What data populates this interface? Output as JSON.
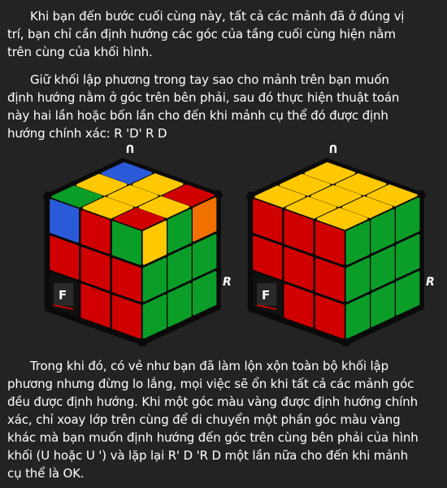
{
  "paragraphs": [
    {
      "lines": [
        "Khi bạn đến bước cuối cùng này, tất cả các mảnh đã ở đúng vị",
        "trí, bạn chỉ cần định hướng các góc của tầng cuối cùng hiện nằm",
        "trên cùng của khối hình."
      ]
    },
    {
      "lines": [
        "Giữ khối lập phương trong tay sao cho mảnh trên bạn muốn",
        "định hướng nằm ở góc trên bên phải, sau đó thực hiện thuật toán",
        "này hai lần hoặc bốn lần cho đến khi mảnh cụ thể đó được định",
        "hướng chính xác: R 'D' R D"
      ]
    },
    {
      "lines": [
        "Trong khi đó, có vẻ như bạn đã làm lộn xộn toàn bộ khối lập",
        "phương nhưng đừng lo lắng, mọi việc sẽ ổn khi tất cả các mảnh góc",
        "đều được định hướng. Khi một góc màu vàng được định hướng chính",
        "xác, chỉ xoay lớp trên cùng để di chuyển một phần góc màu vàng",
        "khác mà bạn muốn định hướng đến góc trên cùng bên phải của hình",
        "khối (U hoặc U ') và lặp lại R' D 'R D một lần nữa cho đến khi mảnh",
        "cụ thể là OK."
      ]
    }
  ],
  "colors": {
    "R": "#d10000",
    "Y": "#ffc800",
    "G": "#0a9e28",
    "B": "#2a5ad8",
    "O": "#f07000",
    "K": "#111111",
    "bg": "#232323"
  },
  "cubes": [
    {
      "labels": {
        "up": "U",
        "right": "R",
        "front": "F"
      },
      "top": [
        [
          "R",
          "Y",
          "R"
        ],
        [
          "Y",
          "Y",
          "Y"
        ],
        [
          "G",
          "Y",
          "B"
        ]
      ],
      "left": [
        [
          "G",
          "R",
          "R"
        ],
        [
          "R",
          "R",
          "R"
        ],
        [
          "B",
          "R",
          "K"
        ]
      ],
      "right": [
        [
          "Y",
          "G",
          "G"
        ],
        [
          "G",
          "G",
          "G"
        ],
        [
          "O",
          "G",
          "G"
        ]
      ]
    },
    {
      "labels": {
        "up": "U",
        "right": "R",
        "front": "F"
      },
      "top": [
        [
          "Y",
          "Y",
          "Y"
        ],
        [
          "Y",
          "Y",
          "Y"
        ],
        [
          "Y",
          "Y",
          "Y"
        ]
      ],
      "left": [
        [
          "R",
          "R",
          "R"
        ],
        [
          "R",
          "R",
          "R"
        ],
        [
          "R",
          "R",
          "K"
        ]
      ],
      "right": [
        [
          "G",
          "G",
          "G"
        ],
        [
          "G",
          "G",
          "G"
        ],
        [
          "G",
          "G",
          "G"
        ]
      ]
    }
  ]
}
